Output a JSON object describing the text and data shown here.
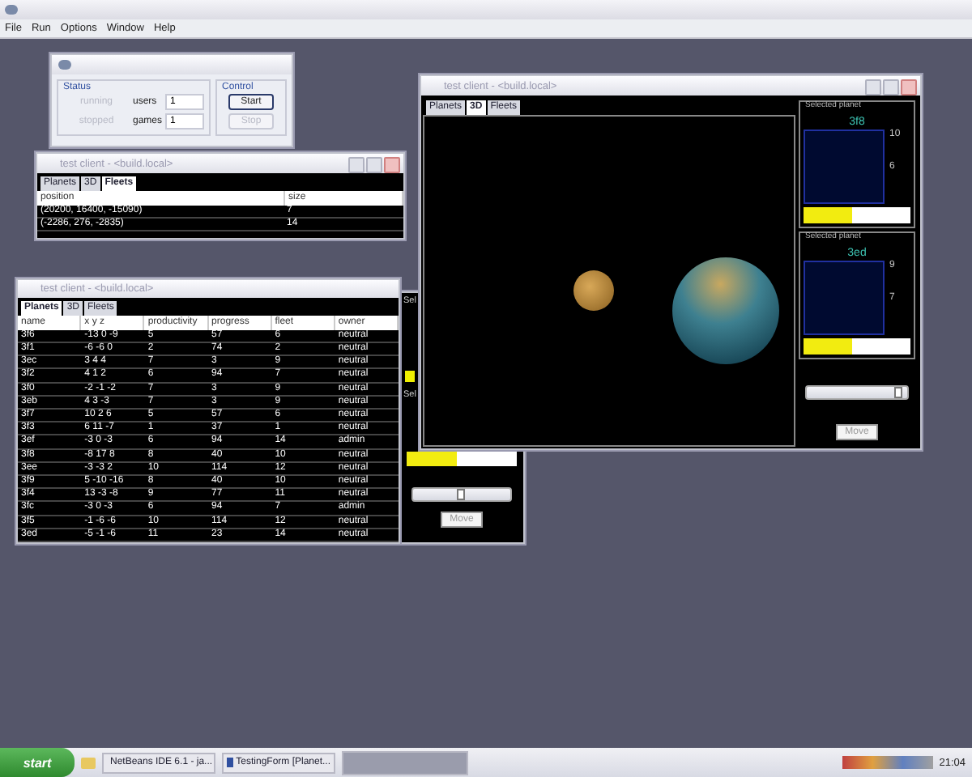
{
  "menu": [
    "File",
    "Run",
    "Options",
    "Window",
    "Help"
  ],
  "status_window": {
    "status_label": "Status",
    "states": [
      {
        "label": "running",
        "disabled": true
      },
      {
        "label": "stopped",
        "disabled": true
      }
    ],
    "fields": [
      {
        "label": "users",
        "value": "1"
      },
      {
        "label": "games",
        "value": "1"
      }
    ],
    "control_label": "Control",
    "buttons": [
      {
        "label": "Start",
        "disabled": false
      },
      {
        "label": "Stop",
        "disabled": true
      }
    ]
  },
  "fleets_window": {
    "title": "test client - <build.local>",
    "tabs": [
      {
        "label": "Planets",
        "selected": false
      },
      {
        "label": "3D",
        "selected": false
      },
      {
        "label": "Fleets",
        "selected": true
      }
    ],
    "columns": [
      "position",
      "size"
    ],
    "rows": [
      [
        "(20200, 16400, -15090)",
        "7"
      ],
      [
        "(-2286, 276, -2835)",
        "14"
      ]
    ]
  },
  "planets_window": {
    "title": "test client - <build.local>",
    "tabs": [
      {
        "label": "Planets",
        "selected": true
      },
      {
        "label": "3D",
        "selected": false
      },
      {
        "label": "Fleets",
        "selected": false
      }
    ],
    "columns": [
      "name",
      "x y z",
      "productivity",
      "progress",
      "fleet",
      "owner"
    ],
    "rows": [
      [
        "3f6",
        "-13 0 -9",
        "5",
        "57",
        "6",
        "neutral"
      ],
      [
        "3f1",
        "-6 -6 0",
        "2",
        "74",
        "2",
        "neutral"
      ],
      [
        "3ec",
        "3 4 4",
        "7",
        "3",
        "9",
        "neutral"
      ],
      [
        "3f2",
        "4 1 2",
        "6",
        "94",
        "7",
        "neutral"
      ],
      [
        "3f0",
        "-2 -1 -2",
        "7",
        "3",
        "9",
        "neutral"
      ],
      [
        "3eb",
        "4 3 -3",
        "7",
        "3",
        "9",
        "neutral"
      ],
      [
        "3f7",
        "10 2 6",
        "5",
        "57",
        "6",
        "neutral"
      ],
      [
        "3f3",
        "6 11 -7",
        "1",
        "37",
        "1",
        "neutral"
      ],
      [
        "3ef",
        "-3 0 -3",
        "6",
        "94",
        "14",
        "admin"
      ],
      [
        "3f8",
        "-8 17 8",
        "8",
        "40",
        "10",
        "neutral"
      ],
      [
        "3ee",
        "-3 -3 2",
        "10",
        "114",
        "12",
        "neutral"
      ],
      [
        "3f9",
        "5 -10 -16",
        "8",
        "40",
        "10",
        "neutral"
      ],
      [
        "3f4",
        "13 -3 -8",
        "9",
        "77",
        "11",
        "neutral"
      ],
      [
        "3fc",
        "-3 0 -3",
        "6",
        "94",
        "7",
        "admin"
      ],
      [
        "3f5",
        "-1 -6 -6",
        "10",
        "114",
        "12",
        "neutral"
      ],
      [
        "3ed",
        "-5 -1 -6",
        "11",
        "23",
        "14",
        "neutral"
      ]
    ]
  },
  "back_window": {
    "labels": [
      "Sel",
      "Sel"
    ],
    "bar": {
      "level": 0.45
    },
    "slider": {
      "level": 0.5
    },
    "button": "Move"
  },
  "view_window": {
    "title": "test client - <build.local>",
    "tabs": [
      {
        "label": "Planets",
        "selected": false
      },
      {
        "label": "3D",
        "selected": true
      },
      {
        "label": "Fleets",
        "selected": false
      }
    ],
    "panels": [
      {
        "label": "Selected planet",
        "name": "3f8",
        "ticks": [
          "10",
          "6"
        ],
        "level": 0.45
      },
      {
        "label": "Selected planet",
        "name": "3ed",
        "ticks": [
          "9",
          "7"
        ],
        "level": 0.45
      }
    ],
    "slider": {
      "level": 0.95
    },
    "button": "Move"
  },
  "taskbar": {
    "start": "start",
    "tasks": [
      {
        "label": "NetBeans IDE 6.1 - ja...",
        "selected": false
      },
      {
        "label": "TestingForm [Planet...",
        "selected": false
      }
    ],
    "clock": "21:04"
  }
}
